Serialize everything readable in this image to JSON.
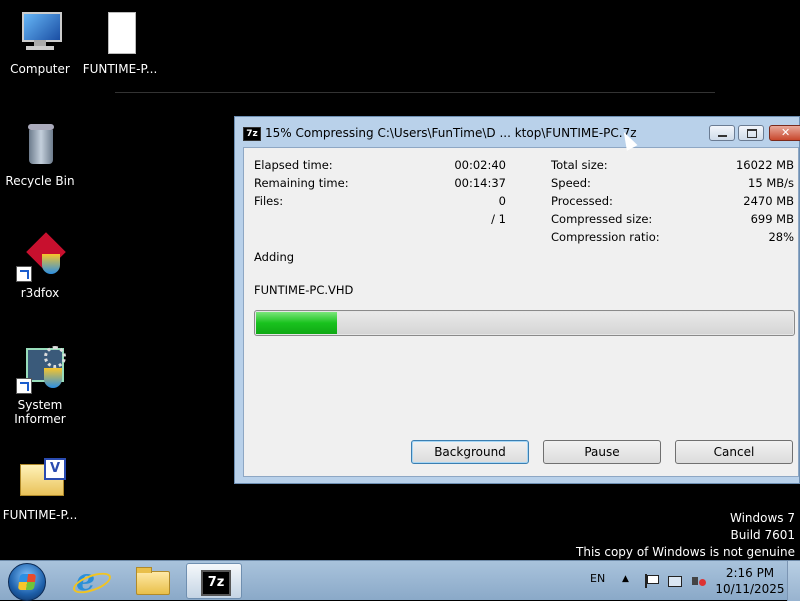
{
  "desktop": {
    "icons": [
      {
        "label": "Computer"
      },
      {
        "label": "FUNTIME-P..."
      },
      {
        "label": "Recycle Bin"
      },
      {
        "label": "r3dfox"
      },
      {
        "label_line1": "System",
        "label_line2": "Informer"
      },
      {
        "label": "FUNTIME-P..."
      }
    ],
    "watermark": {
      "line1": "Windows 7",
      "line2": "Build 7601",
      "line3": "This copy of Windows is not genuine"
    }
  },
  "dialog": {
    "app_icon_text": "7z",
    "title": "15% Compressing C:\\Users\\FunTime\\D ... ktop\\FUNTIME-PC.7z",
    "stats_left": [
      {
        "label": "Elapsed time:",
        "value": "00:02:40"
      },
      {
        "label": "Remaining time:",
        "value": "00:14:37"
      },
      {
        "label": "Files:",
        "value": "0"
      },
      {
        "label": "",
        "value": "/ 1"
      }
    ],
    "stats_right": [
      {
        "label": "Total size:",
        "value": "16022 MB"
      },
      {
        "label": "Speed:",
        "value": "15 MB/s"
      },
      {
        "label": "Processed:",
        "value": "2470 MB"
      },
      {
        "label": "Compressed size:",
        "value": "699 MB"
      },
      {
        "label": "Compression ratio:",
        "value": "28%"
      }
    ],
    "operation": "Adding",
    "current_file": "FUNTIME-PC.VHD",
    "progress_percent": 15,
    "buttons": {
      "background": "Background",
      "pause": "Pause",
      "cancel": "Cancel"
    }
  },
  "taskbar": {
    "language": "EN",
    "time": "2:16 PM",
    "date": "10/11/2025",
    "sevenzip_text": "7z"
  },
  "colors": {
    "progress_fill": "#19c21e",
    "desktop_bg": "#000000",
    "taskbar": "#9bb6d2"
  }
}
